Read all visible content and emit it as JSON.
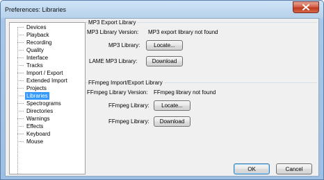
{
  "window": {
    "title": "Preferences: Libraries"
  },
  "tree": {
    "items": [
      {
        "label": "Devices"
      },
      {
        "label": "Playback"
      },
      {
        "label": "Recording"
      },
      {
        "label": "Quality"
      },
      {
        "label": "Interface"
      },
      {
        "label": "Tracks"
      },
      {
        "label": "Import / Export"
      },
      {
        "label": "Extended Import"
      },
      {
        "label": "Projects"
      },
      {
        "label": "Libraries",
        "selected": true
      },
      {
        "label": "Spectrograms"
      },
      {
        "label": "Directories"
      },
      {
        "label": "Warnings"
      },
      {
        "label": "Effects"
      },
      {
        "label": "Keyboard"
      },
      {
        "label": "Mouse"
      }
    ]
  },
  "mp3": {
    "group_title": "MP3 Export Library",
    "version_label": "MP3 Library Version:",
    "version_value": "MP3 export library not found",
    "library_label": "MP3 Library:",
    "locate_button": "Locate...",
    "lame_label": "LAME MP3 Library:",
    "download_button": "Download"
  },
  "ffmpeg": {
    "group_title": "FFmpeg Import/Export Library",
    "version_label": "FFmpeg Library Version:",
    "version_value": "FFmpeg library not found",
    "library_label": "FFmpeg Library:",
    "locate_button": "Locate...",
    "download_label": "FFmpeg Library:",
    "download_button": "Download"
  },
  "footer": {
    "ok_button": "OK",
    "cancel_button": "Cancel"
  }
}
